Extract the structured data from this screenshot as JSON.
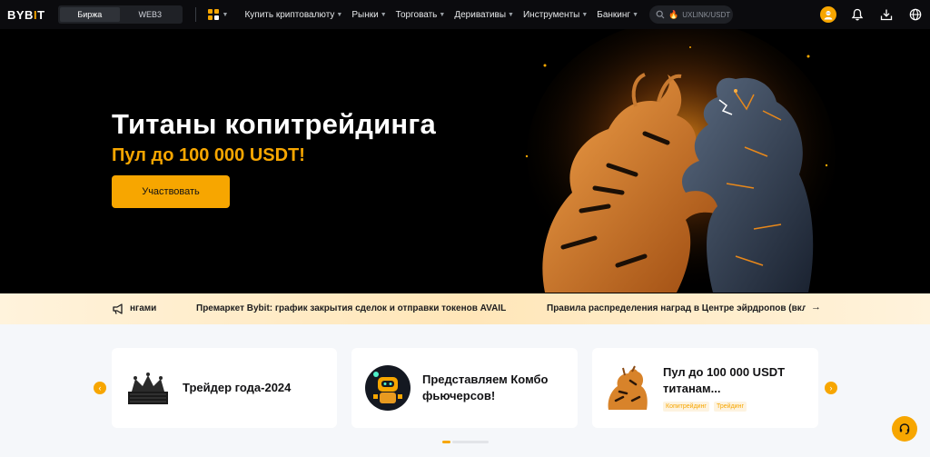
{
  "nav": {
    "logo_main": "BYB",
    "logo_accent": "I",
    "logo_end": "T",
    "segment": [
      "Биржа",
      "WEB3"
    ],
    "menu": [
      "Купить криптовалюту",
      "Рынки",
      "Торговать",
      "Деривативы",
      "Инструменты",
      "Банкинг"
    ],
    "search_value": "UXLINK/USDT"
  },
  "hero": {
    "title": "Титаны копитрейдинга",
    "subtitle": "Пул до 100 000 USDT!",
    "button": "Участвовать"
  },
  "ticker": {
    "items": [
      "нгами",
      "Премаркет Bybit: график закрытия сделок и отправки токенов AVAIL",
      "Правила распределения наград в Центре эйрдропов (вкл"
    ]
  },
  "cards": [
    {
      "title": "Трейдер года-2024"
    },
    {
      "title": "Представляем Комбо фьючерсов!"
    },
    {
      "title": "Пул до 100 000 USDT титанам...",
      "tags": [
        "Копитрейдинг",
        "Трейдинг"
      ]
    }
  ],
  "colors": {
    "accent": "#f7a600",
    "nav_bg": "#0b0b0e",
    "hero_bg": "#000000"
  }
}
